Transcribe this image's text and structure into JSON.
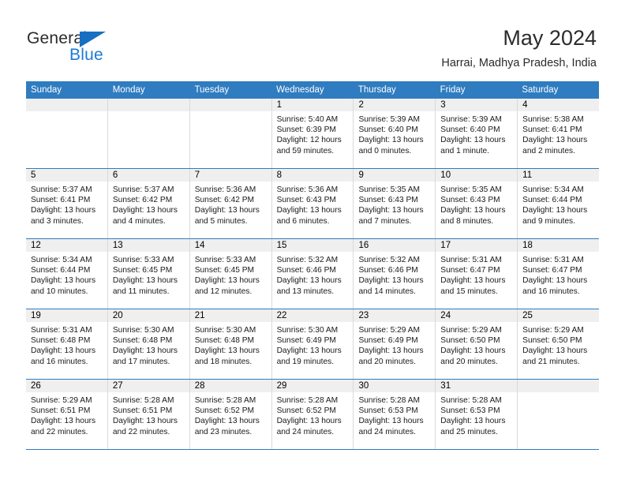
{
  "brand": {
    "name_part1": "General",
    "name_part2": "Blue",
    "triangle_color": "#176fc1",
    "blue_color": "#1b7cd6"
  },
  "header": {
    "title": "May 2024",
    "subtitle": "Harrai, Madhya Pradesh, India"
  },
  "colors": {
    "header_blue": "#2f7cc0",
    "day_number_band": "#efefef",
    "cell_border": "#d9d9d9"
  },
  "weekdays": [
    "Sunday",
    "Monday",
    "Tuesday",
    "Wednesday",
    "Thursday",
    "Friday",
    "Saturday"
  ],
  "weeks": [
    [
      {
        "day": "",
        "sunrise": "",
        "sunset": "",
        "daylight": "",
        "empty": true
      },
      {
        "day": "",
        "sunrise": "",
        "sunset": "",
        "daylight": "",
        "empty": true
      },
      {
        "day": "",
        "sunrise": "",
        "sunset": "",
        "daylight": "",
        "empty": true
      },
      {
        "day": "1",
        "sunrise": "Sunrise: 5:40 AM",
        "sunset": "Sunset: 6:39 PM",
        "daylight": "Daylight: 12 hours and 59 minutes."
      },
      {
        "day": "2",
        "sunrise": "Sunrise: 5:39 AM",
        "sunset": "Sunset: 6:40 PM",
        "daylight": "Daylight: 13 hours and 0 minutes."
      },
      {
        "day": "3",
        "sunrise": "Sunrise: 5:39 AM",
        "sunset": "Sunset: 6:40 PM",
        "daylight": "Daylight: 13 hours and 1 minute."
      },
      {
        "day": "4",
        "sunrise": "Sunrise: 5:38 AM",
        "sunset": "Sunset: 6:41 PM",
        "daylight": "Daylight: 13 hours and 2 minutes."
      }
    ],
    [
      {
        "day": "5",
        "sunrise": "Sunrise: 5:37 AM",
        "sunset": "Sunset: 6:41 PM",
        "daylight": "Daylight: 13 hours and 3 minutes."
      },
      {
        "day": "6",
        "sunrise": "Sunrise: 5:37 AM",
        "sunset": "Sunset: 6:42 PM",
        "daylight": "Daylight: 13 hours and 4 minutes."
      },
      {
        "day": "7",
        "sunrise": "Sunrise: 5:36 AM",
        "sunset": "Sunset: 6:42 PM",
        "daylight": "Daylight: 13 hours and 5 minutes."
      },
      {
        "day": "8",
        "sunrise": "Sunrise: 5:36 AM",
        "sunset": "Sunset: 6:43 PM",
        "daylight": "Daylight: 13 hours and 6 minutes."
      },
      {
        "day": "9",
        "sunrise": "Sunrise: 5:35 AM",
        "sunset": "Sunset: 6:43 PM",
        "daylight": "Daylight: 13 hours and 7 minutes."
      },
      {
        "day": "10",
        "sunrise": "Sunrise: 5:35 AM",
        "sunset": "Sunset: 6:43 PM",
        "daylight": "Daylight: 13 hours and 8 minutes."
      },
      {
        "day": "11",
        "sunrise": "Sunrise: 5:34 AM",
        "sunset": "Sunset: 6:44 PM",
        "daylight": "Daylight: 13 hours and 9 minutes."
      }
    ],
    [
      {
        "day": "12",
        "sunrise": "Sunrise: 5:34 AM",
        "sunset": "Sunset: 6:44 PM",
        "daylight": "Daylight: 13 hours and 10 minutes."
      },
      {
        "day": "13",
        "sunrise": "Sunrise: 5:33 AM",
        "sunset": "Sunset: 6:45 PM",
        "daylight": "Daylight: 13 hours and 11 minutes."
      },
      {
        "day": "14",
        "sunrise": "Sunrise: 5:33 AM",
        "sunset": "Sunset: 6:45 PM",
        "daylight": "Daylight: 13 hours and 12 minutes."
      },
      {
        "day": "15",
        "sunrise": "Sunrise: 5:32 AM",
        "sunset": "Sunset: 6:46 PM",
        "daylight": "Daylight: 13 hours and 13 minutes."
      },
      {
        "day": "16",
        "sunrise": "Sunrise: 5:32 AM",
        "sunset": "Sunset: 6:46 PM",
        "daylight": "Daylight: 13 hours and 14 minutes."
      },
      {
        "day": "17",
        "sunrise": "Sunrise: 5:31 AM",
        "sunset": "Sunset: 6:47 PM",
        "daylight": "Daylight: 13 hours and 15 minutes."
      },
      {
        "day": "18",
        "sunrise": "Sunrise: 5:31 AM",
        "sunset": "Sunset: 6:47 PM",
        "daylight": "Daylight: 13 hours and 16 minutes."
      }
    ],
    [
      {
        "day": "19",
        "sunrise": "Sunrise: 5:31 AM",
        "sunset": "Sunset: 6:48 PM",
        "daylight": "Daylight: 13 hours and 16 minutes."
      },
      {
        "day": "20",
        "sunrise": "Sunrise: 5:30 AM",
        "sunset": "Sunset: 6:48 PM",
        "daylight": "Daylight: 13 hours and 17 minutes."
      },
      {
        "day": "21",
        "sunrise": "Sunrise: 5:30 AM",
        "sunset": "Sunset: 6:48 PM",
        "daylight": "Daylight: 13 hours and 18 minutes."
      },
      {
        "day": "22",
        "sunrise": "Sunrise: 5:30 AM",
        "sunset": "Sunset: 6:49 PM",
        "daylight": "Daylight: 13 hours and 19 minutes."
      },
      {
        "day": "23",
        "sunrise": "Sunrise: 5:29 AM",
        "sunset": "Sunset: 6:49 PM",
        "daylight": "Daylight: 13 hours and 20 minutes."
      },
      {
        "day": "24",
        "sunrise": "Sunrise: 5:29 AM",
        "sunset": "Sunset: 6:50 PM",
        "daylight": "Daylight: 13 hours and 20 minutes."
      },
      {
        "day": "25",
        "sunrise": "Sunrise: 5:29 AM",
        "sunset": "Sunset: 6:50 PM",
        "daylight": "Daylight: 13 hours and 21 minutes."
      }
    ],
    [
      {
        "day": "26",
        "sunrise": "Sunrise: 5:29 AM",
        "sunset": "Sunset: 6:51 PM",
        "daylight": "Daylight: 13 hours and 22 minutes."
      },
      {
        "day": "27",
        "sunrise": "Sunrise: 5:28 AM",
        "sunset": "Sunset: 6:51 PM",
        "daylight": "Daylight: 13 hours and 22 minutes."
      },
      {
        "day": "28",
        "sunrise": "Sunrise: 5:28 AM",
        "sunset": "Sunset: 6:52 PM",
        "daylight": "Daylight: 13 hours and 23 minutes."
      },
      {
        "day": "29",
        "sunrise": "Sunrise: 5:28 AM",
        "sunset": "Sunset: 6:52 PM",
        "daylight": "Daylight: 13 hours and 24 minutes."
      },
      {
        "day": "30",
        "sunrise": "Sunrise: 5:28 AM",
        "sunset": "Sunset: 6:53 PM",
        "daylight": "Daylight: 13 hours and 24 minutes."
      },
      {
        "day": "31",
        "sunrise": "Sunrise: 5:28 AM",
        "sunset": "Sunset: 6:53 PM",
        "daylight": "Daylight: 13 hours and 25 minutes."
      },
      {
        "day": "",
        "sunrise": "",
        "sunset": "",
        "daylight": "",
        "empty": true
      }
    ]
  ]
}
